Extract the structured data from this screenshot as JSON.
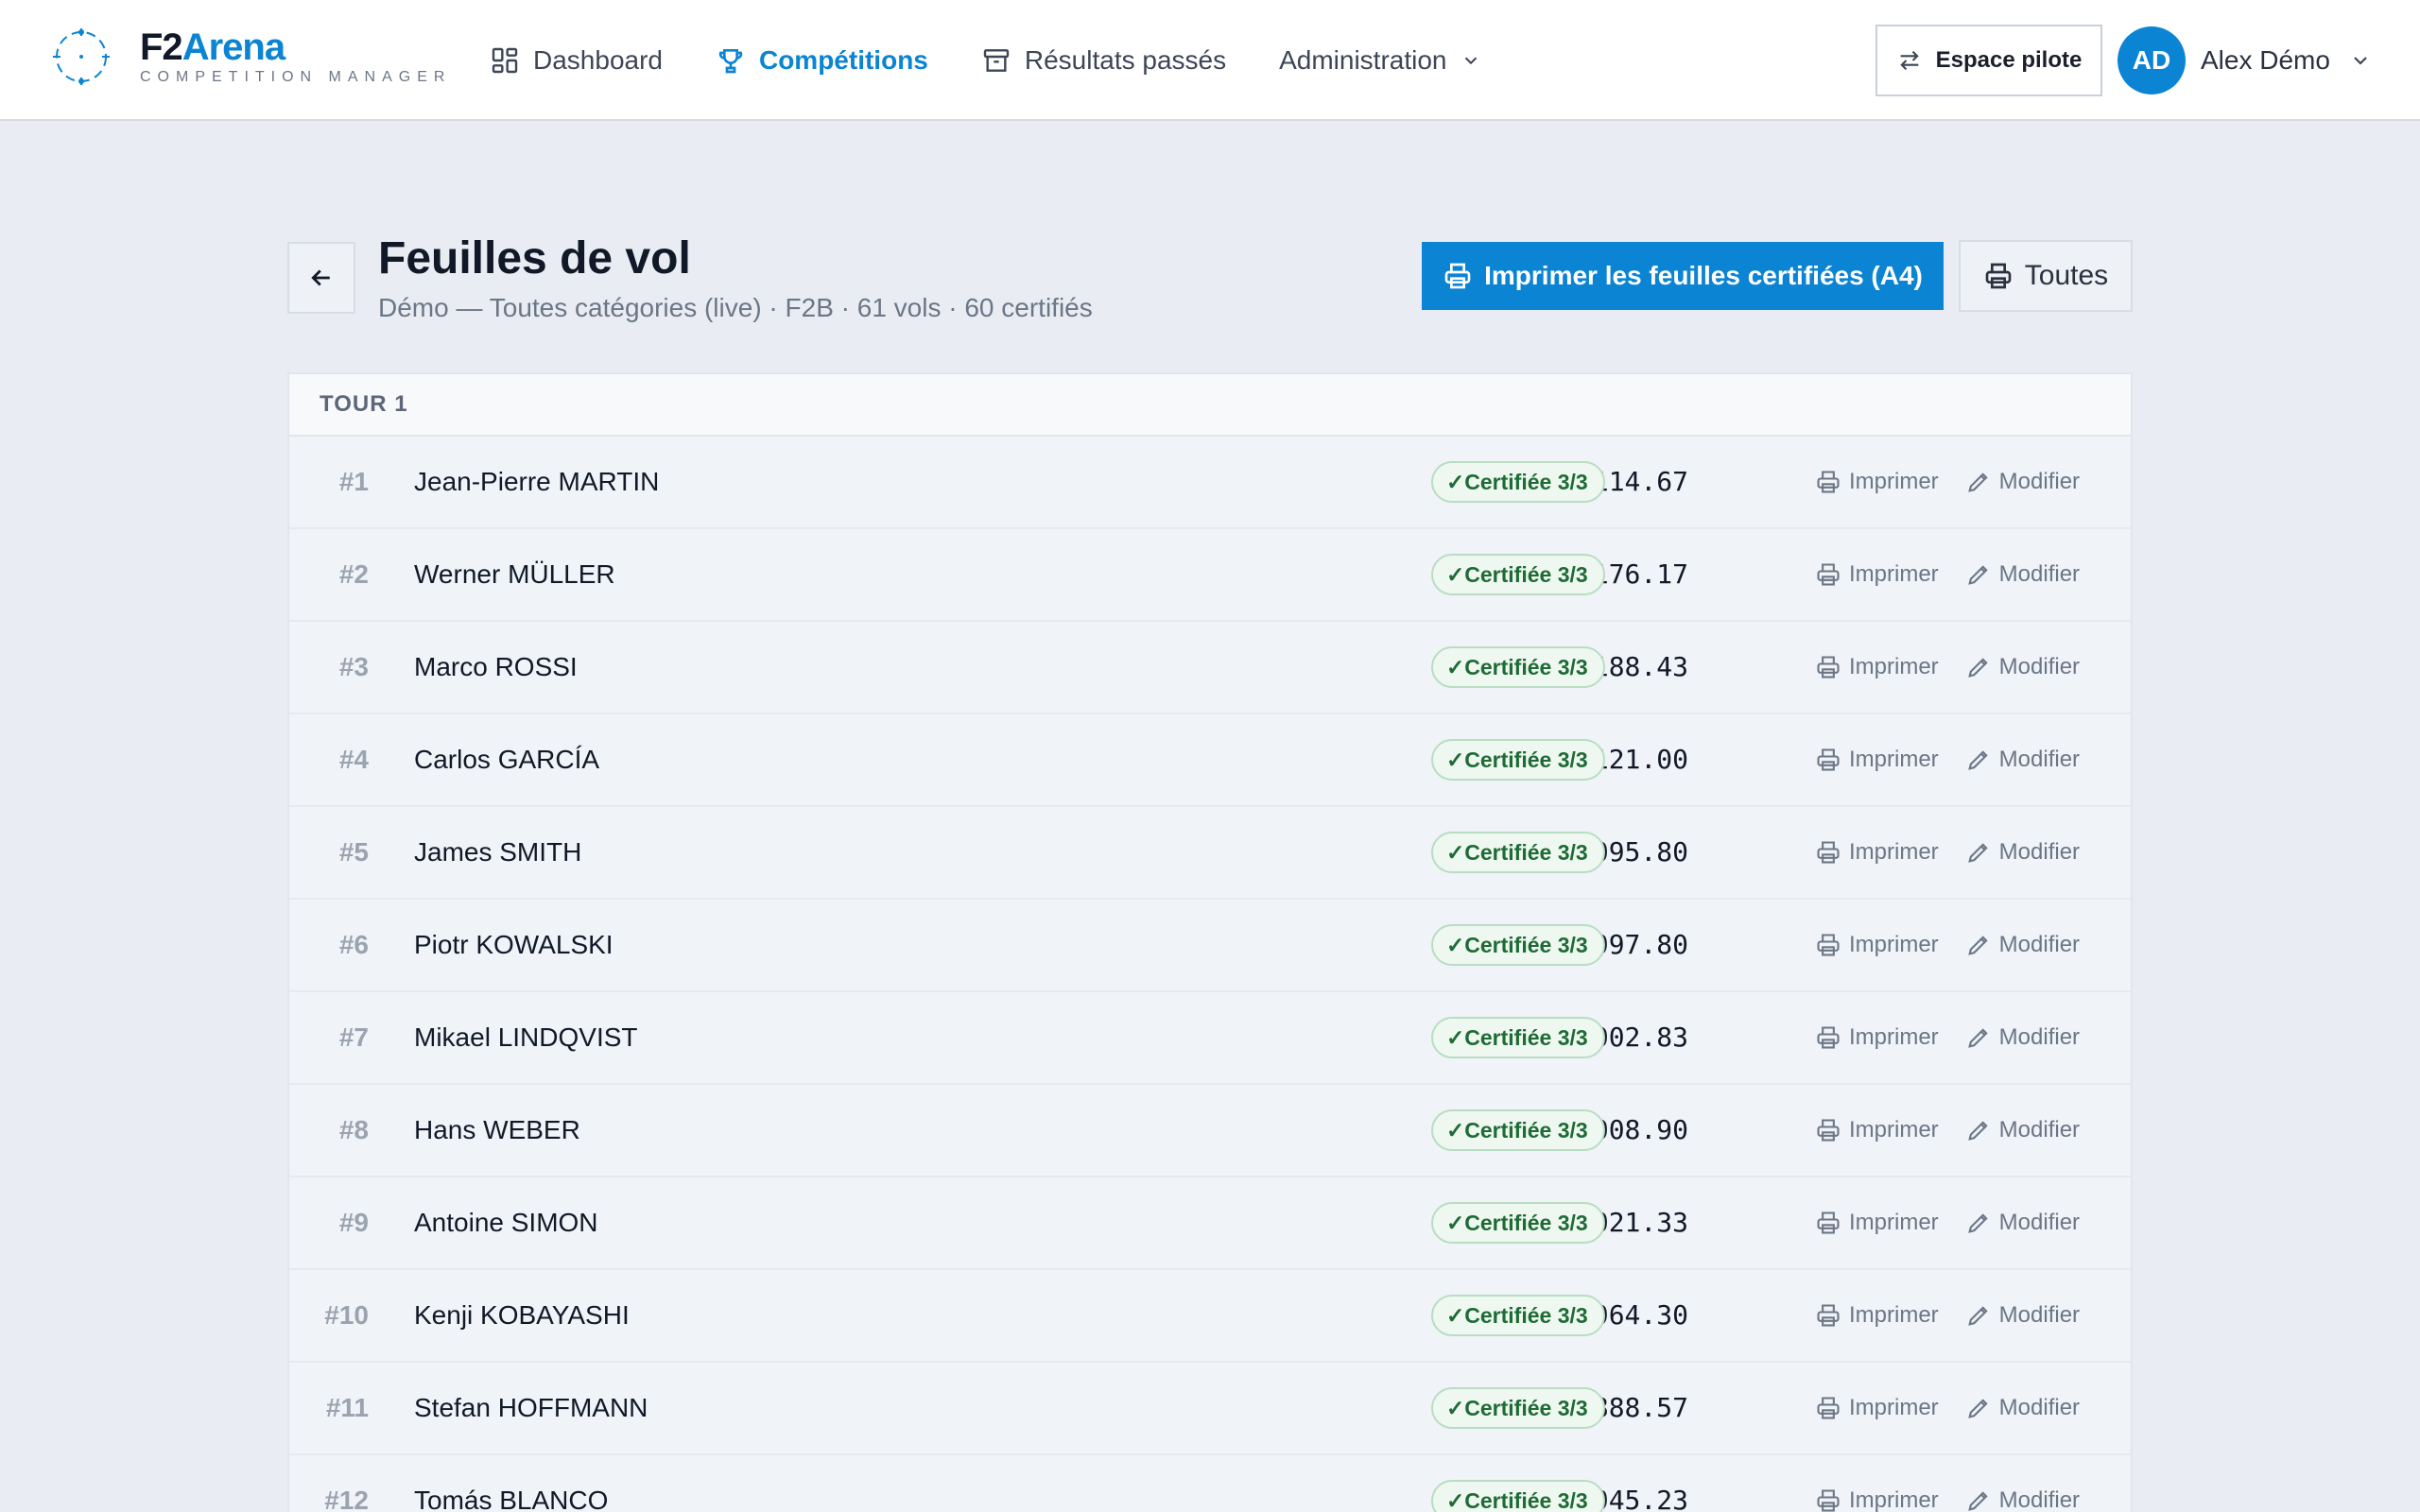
{
  "brand": {
    "name_a": "F2",
    "name_b": "Arena",
    "subtitle": "COMPETITION MANAGER",
    "accent": "#0b84d4"
  },
  "nav": {
    "items": [
      {
        "label": "Dashboard",
        "icon": "dashboard-grid-icon"
      },
      {
        "label": "Compétitions",
        "icon": "trophy-icon",
        "active": true
      },
      {
        "label": "Résultats passés",
        "icon": "archive-icon"
      },
      {
        "label": "Administration",
        "icon": "chevron-down-icon"
      }
    ]
  },
  "header": {
    "pilot_space_label": "Espace pilote",
    "user_initials": "AD",
    "user_name": "Alex Démo"
  },
  "page": {
    "title": "Feuilles de vol",
    "subtitle": "Démo — Toutes catégories (live) · F2B · 61 vols · 60 certifiés",
    "print_certified_label": "Imprimer les feuilles certifiées (A4)",
    "print_all_label": "Toutes"
  },
  "round": {
    "label": "TOUR 1"
  },
  "actions": {
    "print_label": "Imprimer",
    "edit_label": "Modifier"
  },
  "rows": [
    {
      "rank": "#1",
      "pilot": "Jean-Pierre MARTIN",
      "score": "1114.67",
      "status": "✓Certifiée 3/3"
    },
    {
      "rank": "#2",
      "pilot": "Werner MÜLLER",
      "score": "1176.17",
      "status": "✓Certifiée 3/3"
    },
    {
      "rank": "#3",
      "pilot": "Marco ROSSI",
      "score": "1188.43",
      "status": "✓Certifiée 3/3"
    },
    {
      "rank": "#4",
      "pilot": "Carlos GARCÍA",
      "score": "1121.00",
      "status": "✓Certifiée 3/3"
    },
    {
      "rank": "#5",
      "pilot": "James SMITH",
      "score": "1095.80",
      "status": "✓Certifiée 3/3"
    },
    {
      "rank": "#6",
      "pilot": "Piotr KOWALSKI",
      "score": "997.80",
      "status": "✓Certifiée 3/3"
    },
    {
      "rank": "#7",
      "pilot": "Mikael LINDQVIST",
      "score": "1002.83",
      "status": "✓Certifiée 3/3"
    },
    {
      "rank": "#8",
      "pilot": "Hans WEBER",
      "score": "1008.90",
      "status": "✓Certifiée 3/3"
    },
    {
      "rank": "#9",
      "pilot": "Antoine SIMON",
      "score": "1021.33",
      "status": "✓Certifiée 3/3"
    },
    {
      "rank": "#10",
      "pilot": "Kenji KOBAYASHI",
      "score": "964.30",
      "status": "✓Certifiée 3/3"
    },
    {
      "rank": "#11",
      "pilot": "Stefan HOFFMANN",
      "score": "888.57",
      "status": "✓Certifiée 3/3"
    },
    {
      "rank": "#12",
      "pilot": "Tomás BLANCO",
      "score": "945.23",
      "status": "✓Certifiée 3/3"
    }
  ]
}
